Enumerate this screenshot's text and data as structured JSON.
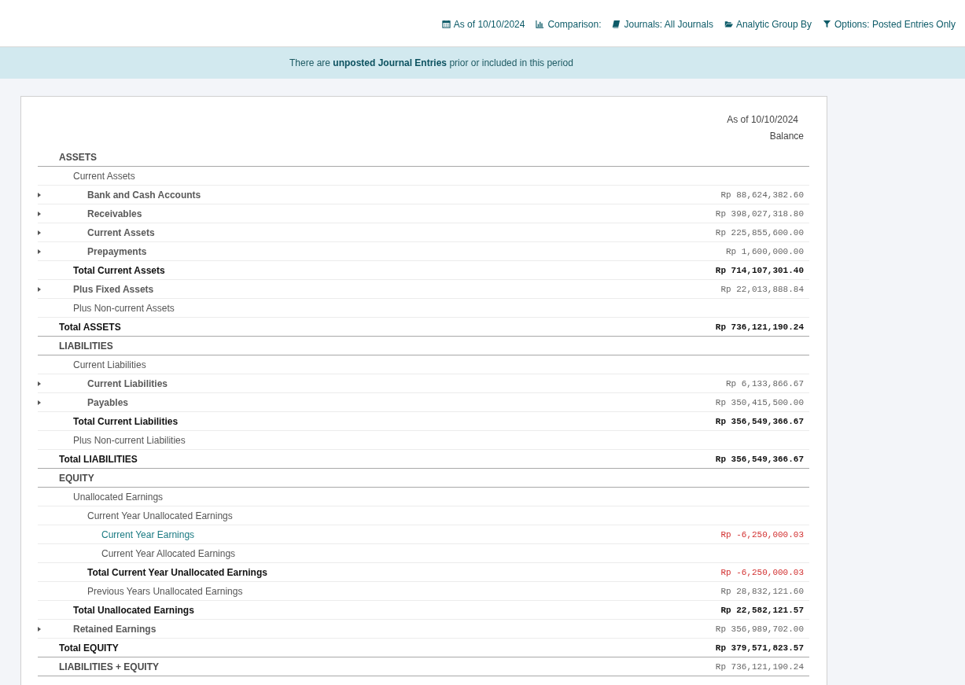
{
  "toolbar": [
    {
      "kind": "date",
      "label": "As of 10/10/2024"
    },
    {
      "kind": "comparison",
      "label": "Comparison:"
    },
    {
      "kind": "journals",
      "label": "Journals: All Journals"
    },
    {
      "kind": "analytic",
      "label": "Analytic Group By"
    },
    {
      "kind": "options",
      "label": "Options: Posted Entries Only"
    }
  ],
  "alert": "There are **unposted Journal Entries** prior or included in this period",
  "report": {
    "column_date": "As of 10/10/2024",
    "column_title": "Balance",
    "rows": [
      {
        "kind": "header",
        "label": "ASSETS",
        "expandable": false,
        "children": [
          {
            "kind": "group",
            "label": "Current Assets",
            "expandable": false,
            "children": [
              {
                "kind": "line",
                "label": "Bank and Cash Accounts",
                "value": "Rp 88,624,382.60",
                "expandable": true,
                "negative": false
              },
              {
                "kind": "line",
                "label": "Receivables",
                "value": "Rp 398,027,318.80",
                "expandable": true,
                "negative": false
              },
              {
                "kind": "line",
                "label": "Current Assets",
                "value": "Rp 225,855,600.00",
                "expandable": true,
                "negative": false
              },
              {
                "kind": "line",
                "label": "Prepayments",
                "value": "Rp 1,600,000.00",
                "expandable": true,
                "negative": false
              }
            ]
          },
          {
            "kind": "total",
            "label": "Total Current Assets",
            "value": "Rp 714,107,301.40",
            "expandable": false,
            "negative": false
          },
          {
            "kind": "line",
            "label": "Plus Fixed Assets",
            "value": "Rp 22,013,888.84",
            "expandable": true,
            "negative": false
          },
          {
            "kind": "group",
            "label": "Plus Non-current Assets",
            "expandable": false
          }
        ]
      },
      {
        "kind": "total",
        "label": "Total ASSETS",
        "value": "Rp 736,121,190.24",
        "expandable": false,
        "negative": false
      },
      {
        "kind": "header",
        "label": "LIABILITIES",
        "expandable": false,
        "children": [
          {
            "kind": "group",
            "label": "Current Liabilities",
            "expandable": false,
            "children": [
              {
                "kind": "line",
                "label": "Current Liabilities",
                "value": "Rp 6,133,866.67",
                "expandable": true,
                "negative": false
              },
              {
                "kind": "line",
                "label": "Payables",
                "value": "Rp 350,415,500.00",
                "expandable": true,
                "negative": false
              }
            ]
          },
          {
            "kind": "total",
            "label": "Total Current Liabilities",
            "value": "Rp 356,549,366.67",
            "expandable": false,
            "negative": false
          },
          {
            "kind": "group",
            "label": "Plus Non-current Liabilities",
            "expandable": false
          }
        ]
      },
      {
        "kind": "total",
        "label": "Total LIABILITIES",
        "value": "Rp 356,549,366.67",
        "expandable": false,
        "negative": false
      },
      {
        "kind": "header",
        "label": "EQUITY",
        "expandable": false,
        "children": [
          {
            "kind": "group",
            "label": "Unallocated Earnings",
            "expandable": false,
            "children": [
              {
                "kind": "group",
                "label": "Current Year Unallocated Earnings",
                "expandable": false,
                "children": [
                  {
                    "kind": "link",
                    "label": "Current Year Earnings",
                    "value": "Rp -6,250,000.03",
                    "expandable": false,
                    "negative": true
                  },
                  {
                    "kind": "group",
                    "label": "Current Year Allocated Earnings",
                    "expandable": false
                  }
                ]
              },
              {
                "kind": "total",
                "label": "Total Current Year Unallocated Earnings",
                "value": "Rp -6,250,000.03",
                "expandable": false,
                "negative": true
              },
              {
                "kind": "group",
                "label": "Previous Years Unallocated Earnings",
                "value": "Rp 28,832,121.60",
                "expandable": false,
                "negative": false
              }
            ]
          },
          {
            "kind": "total",
            "label": "Total Unallocated Earnings",
            "value": "Rp 22,582,121.57",
            "expandable": false,
            "negative": false
          },
          {
            "kind": "line",
            "label": "Retained Earnings",
            "value": "Rp 356,989,702.00",
            "expandable": true,
            "negative": false
          }
        ]
      },
      {
        "kind": "total",
        "label": "Total EQUITY",
        "value": "Rp 379,571,823.57",
        "expandable": false,
        "negative": false
      },
      {
        "kind": "header",
        "label": "LIABILITIES + EQUITY",
        "value": "Rp 736,121,190.24",
        "expandable": false,
        "negative": false
      }
    ]
  }
}
